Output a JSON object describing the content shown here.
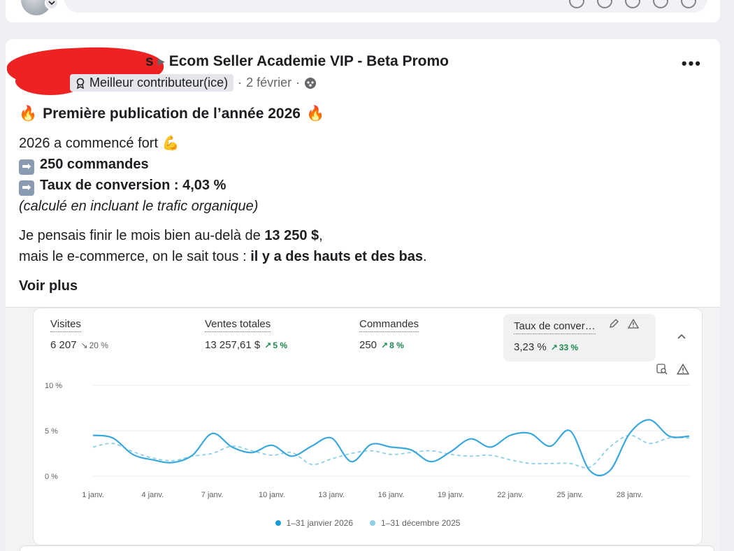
{
  "post": {
    "author_visible_tail": "s",
    "group_name": "Ecom Seller Academie VIP - Beta Promo",
    "badge_label": "Meilleur contributeur(ice)",
    "separator": "·",
    "date": "2 février",
    "title": "Première publication de l’année 2026",
    "line_intro": "2026 a commencé fort",
    "line_orders": "250 commandes",
    "line_conversion": "Taux de conversion : 4,03 %",
    "line_note": "(calculé en incluant le trafic organique)",
    "para2_a": "Je pensais finir le mois bien au-delà de ",
    "para2_b": "13 250 $",
    "para2_c": ",",
    "para3_a": "mais le e-commerce, on le sait tous : ",
    "para3_b": "il y a des hauts et des bas",
    "para3_c": ".",
    "see_more": "Voir plus",
    "emoji_fire": "🔥",
    "emoji_muscle": "💪",
    "arrow_glyph": "➡"
  },
  "metrics": [
    {
      "label": "Visites",
      "value": "6 207",
      "delta": "20 %",
      "direction": "down"
    },
    {
      "label": "Ventes totales",
      "value": "13 257,61 $",
      "delta": "5 %",
      "direction": "up"
    },
    {
      "label": "Commandes",
      "value": "250",
      "delta": "8 %",
      "direction": "up"
    },
    {
      "label": "Taux de conver…",
      "value": "3,23 %",
      "delta": "33 %",
      "direction": "up"
    }
  ],
  "colors": {
    "current_series": "#3aa8dc",
    "previous_series": "#8ccfe8",
    "up": "#1a8a4d",
    "down": "#616161"
  },
  "chart_data": {
    "type": "line",
    "yticks": [
      "10 %",
      "5 %",
      "0 %"
    ],
    "ylim": [
      0,
      10
    ],
    "x": [
      "1 janv.",
      "2",
      "3",
      "4 janv.",
      "5",
      "6",
      "7 janv.",
      "8",
      "9",
      "10 janv.",
      "11",
      "12",
      "13 janv.",
      "14",
      "15",
      "16 janv.",
      "17",
      "18",
      "19 janv.",
      "20",
      "21",
      "22 janv.",
      "23",
      "24",
      "25 janv.",
      "26",
      "27",
      "28 janv.",
      "29",
      "30",
      "31"
    ],
    "xtick_labels": [
      "1 janv.",
      "4 janv.",
      "7 janv.",
      "10 janv.",
      "13 janv.",
      "16 janv.",
      "19 janv.",
      "22 janv.",
      "25 janv.",
      "28 janv."
    ],
    "series": [
      {
        "name": "1–31 janvier 2026",
        "style": "solid",
        "values": [
          4.5,
          4.2,
          2.4,
          1.8,
          1.5,
          2.3,
          4.7,
          3.2,
          2.6,
          3.4,
          2.2,
          3.3,
          4.2,
          1.6,
          3.5,
          3.2,
          2.9,
          1.6,
          2.7,
          4.1,
          3.2,
          4.5,
          4.7,
          3.3,
          5.0,
          0.6,
          0.6,
          4.7,
          6.2,
          4.4,
          4.4
        ]
      },
      {
        "name": "1–31 décembre 2025",
        "style": "dashed",
        "values": [
          3.2,
          3.6,
          2.7,
          2.0,
          1.7,
          2.2,
          2.5,
          3.3,
          2.8,
          2.3,
          2.6,
          1.3,
          1.9,
          2.5,
          2.8,
          2.4,
          2.6,
          2.8,
          2.4,
          2.2,
          2.3,
          1.8,
          1.4,
          1.4,
          1.4,
          1.0,
          3.2,
          4.5,
          3.6,
          4.2,
          4.2
        ]
      }
    ]
  }
}
